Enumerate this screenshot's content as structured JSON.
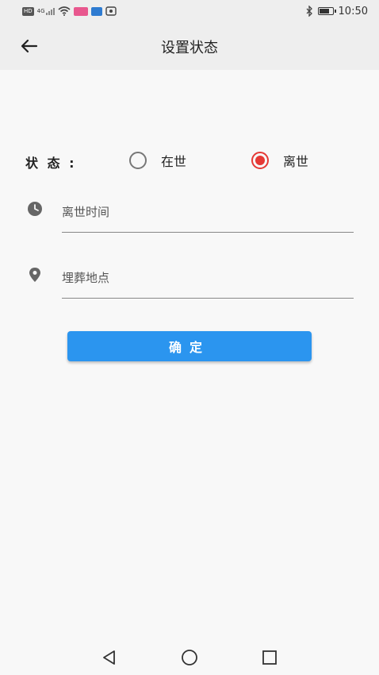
{
  "status_bar": {
    "left_icons": [
      "hd-icon",
      "4g-signal-icon",
      "wifi-icon",
      "app-notification-icon",
      "app-notification-icon",
      "eye-icon"
    ],
    "network_label": "4G",
    "time": "10:50",
    "battery_level": 0.7
  },
  "app_bar": {
    "title": "设置状态",
    "back_icon": "arrow-left-icon"
  },
  "status_selector": {
    "label": "状 态 :",
    "options": [
      {
        "label": "在世",
        "selected": false
      },
      {
        "label": "离世",
        "selected": true
      }
    ],
    "accent_color": "#e53935"
  },
  "fields": {
    "death_time": {
      "icon": "clock-icon",
      "placeholder": "离世时间",
      "value": ""
    },
    "burial_place": {
      "icon": "location-pin-icon",
      "placeholder": "埋葬地点",
      "value": ""
    }
  },
  "confirm_button": {
    "label": "确定",
    "color": "#2b95ef"
  },
  "nav_bar": {
    "back": "triangle-back-icon",
    "home": "circle-home-icon",
    "recents": "square-recents-icon"
  }
}
